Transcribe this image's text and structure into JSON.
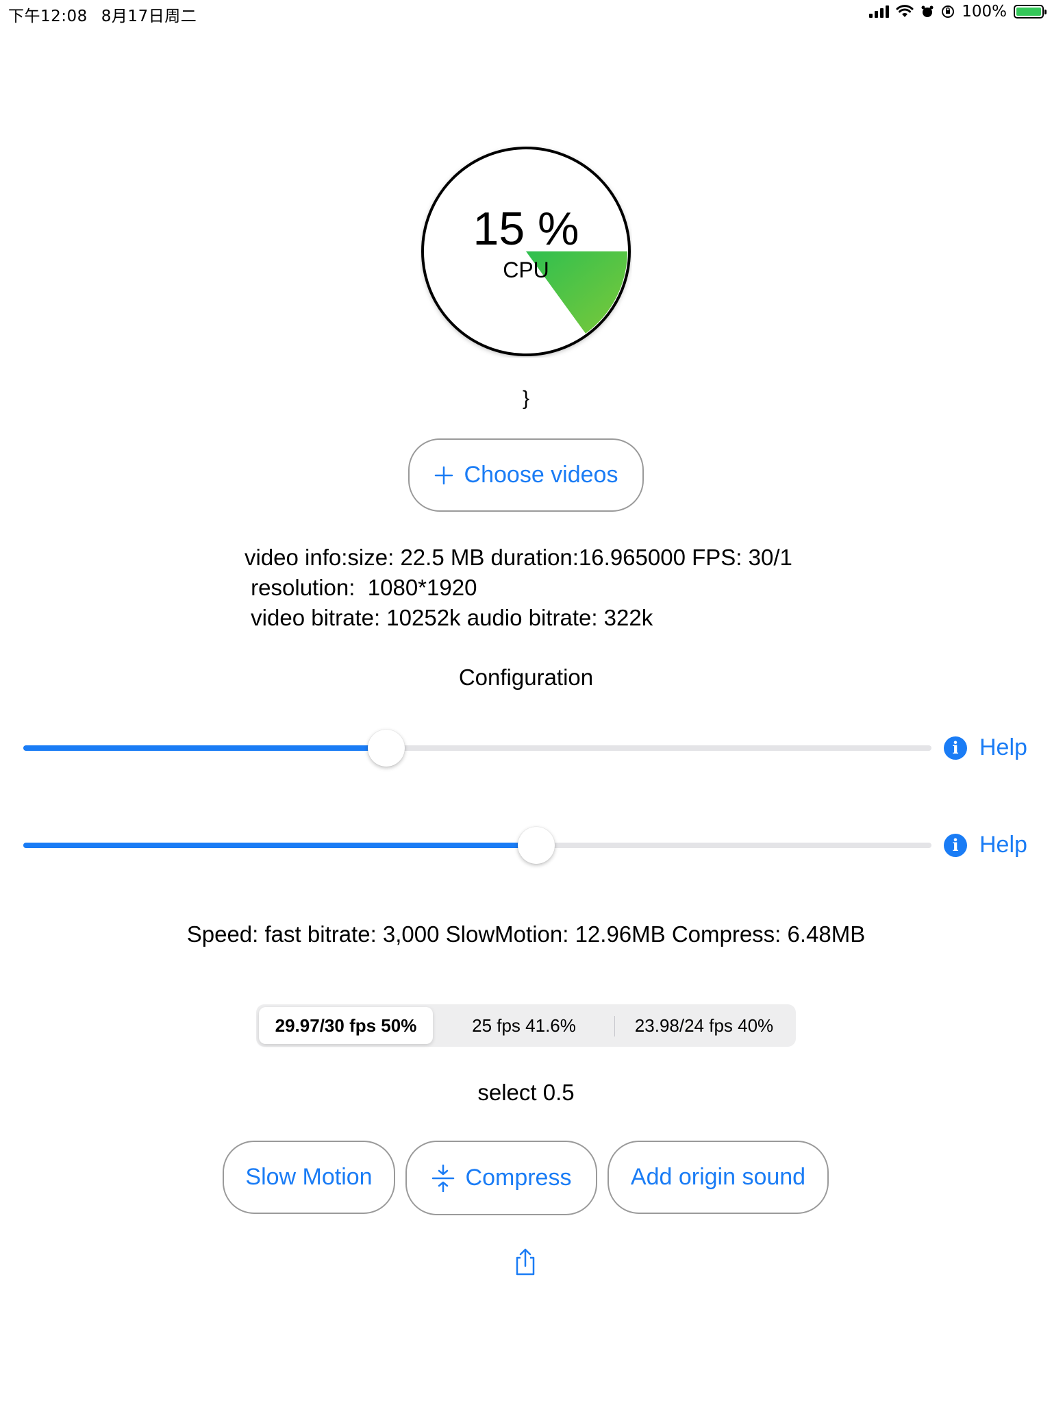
{
  "status_bar": {
    "time": "下午12:08",
    "date": "8月17日周二",
    "battery": "100%"
  },
  "gauge": {
    "value_text": "15 %",
    "label": "CPU",
    "percent": 15,
    "fill_color": "#34c759"
  },
  "brace_text": "}",
  "choose_button": {
    "label": "Choose videos",
    "icon": "plus-icon"
  },
  "video_info": {
    "line1": "video info:size: 22.5 MB duration:16.965000 FPS: 30/1",
    "line2": " resolution:  1080*1920",
    "line3": " video bitrate: 10252k audio bitrate: 322k"
  },
  "configuration_title": "Configuration",
  "sliders": [
    {
      "value": 0.4,
      "help_label": "Help"
    },
    {
      "value": 0.565,
      "help_label": "Help"
    }
  ],
  "speed_text": "Speed: fast bitrate: 3,000 SlowMotion: 12.96MB Compress: 6.48MB",
  "segmented": {
    "options": [
      "29.97/30 fps 50%",
      "25 fps 41.6%",
      "23.98/24 fps 40%"
    ],
    "selected_index": 0
  },
  "select_text": "select 0.5",
  "buttons": {
    "slow_motion": "Slow Motion",
    "compress": "Compress",
    "add_origin_sound": "Add origin sound"
  },
  "accent_color": "#1a7cf5"
}
